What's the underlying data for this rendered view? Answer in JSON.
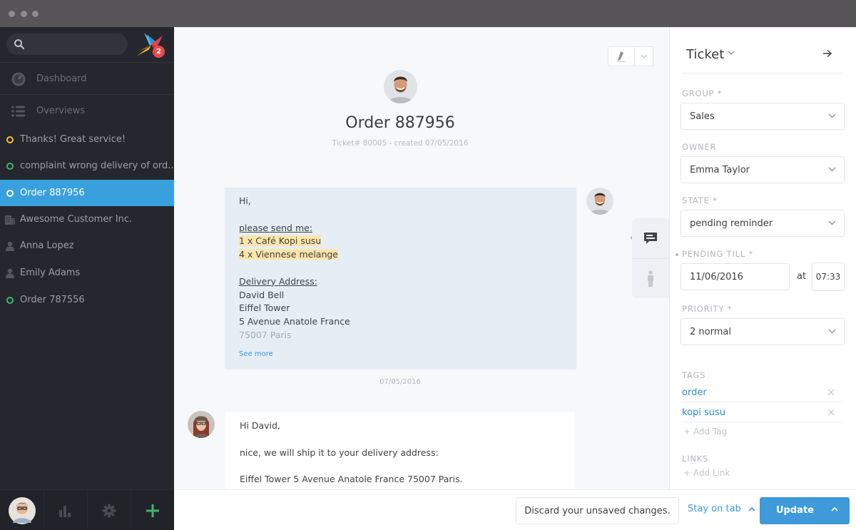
{
  "window": {
    "controls": [
      "close",
      "minimize",
      "maximize"
    ]
  },
  "sidebar": {
    "search": {
      "placeholder": "",
      "value": "",
      "icon": "search-icon"
    },
    "logo": {
      "icon": "zammad-bird-logo",
      "notification_count": "2"
    },
    "nav": [
      {
        "label": "Dashboard",
        "icon": "speedometer-icon"
      },
      {
        "label": "Overviews",
        "icon": "list-icon"
      }
    ],
    "items": [
      {
        "label": "Thanks! Great service!",
        "type": "ticket",
        "status_color": "#f4c22b",
        "active": false
      },
      {
        "label": "complaint wrong delivery of ord...",
        "type": "ticket",
        "status_color": "#3fb46b",
        "active": false
      },
      {
        "label": "Order 887956",
        "type": "ticket",
        "status_color": "#ffffff",
        "active": true
      },
      {
        "label": "Awesome Customer Inc.",
        "type": "organization",
        "icon": "building-icon",
        "active": false
      },
      {
        "label": "Anna Lopez",
        "type": "user",
        "icon": "person-icon",
        "active": false
      },
      {
        "label": "Emily Adams",
        "type": "user",
        "icon": "person-icon",
        "active": false
      },
      {
        "label": "Order 787556",
        "type": "ticket",
        "status_color": "#3fb46b",
        "active": false
      }
    ],
    "footer": [
      {
        "name": "avatar",
        "icon": "user-avatar"
      },
      {
        "name": "reports",
        "icon": "bar-chart-icon"
      },
      {
        "name": "settings",
        "icon": "gear-icon"
      },
      {
        "name": "new",
        "icon": "plus-icon",
        "color": "#3fb46b"
      }
    ]
  },
  "ticket": {
    "title": "Order 887956",
    "meta": "Ticket# 80005 - created 07/05/2016",
    "highlighter_icon": "highlighter-icon",
    "articles": [
      {
        "sender": "customer",
        "lines": [
          {
            "text": "Hi,",
            "style": "normal"
          },
          {
            "text": "",
            "style": "blank"
          },
          {
            "text": "please send me:",
            "style": "underline"
          },
          {
            "text": "1 x Café Kopi susu",
            "style": "highlight"
          },
          {
            "text": "4 x Viennese melange",
            "style": "highlight"
          },
          {
            "text": "",
            "style": "blank"
          },
          {
            "text": "Delivery Address:",
            "style": "underline"
          },
          {
            "text": "David Bell",
            "style": "normal"
          },
          {
            "text": "Eiffel Tower",
            "style": "normal"
          },
          {
            "text": "5 Avenue Anatole France",
            "style": "normal"
          },
          {
            "text": "75007 Paris",
            "style": "faded"
          }
        ],
        "see_more": "See more"
      },
      {
        "sender": "agent",
        "lines": [
          {
            "text": "Hi David,",
            "style": "normal"
          },
          {
            "text": "",
            "style": "blank"
          },
          {
            "text": "nice, we will ship it to your delivery address:",
            "style": "normal"
          },
          {
            "text": "",
            "style": "blank"
          },
          {
            "text": "Eiffel Tower 5 Avenue Anatole France 75007 Paris.",
            "style": "normal"
          }
        ]
      }
    ],
    "date_separator": "07/05/2016",
    "side_tabs": [
      {
        "name": "ticket",
        "icon": "chat-bubble-icon",
        "active": true
      },
      {
        "name": "customer",
        "icon": "person-icon",
        "active": false
      }
    ]
  },
  "panel": {
    "title": "Ticket",
    "fields": {
      "group": {
        "label": "GROUP *",
        "value": "Sales"
      },
      "owner": {
        "label": "OWNER",
        "value": "Emma Taylor"
      },
      "state": {
        "label": "STATE *",
        "value": "pending reminder"
      },
      "pending_till": {
        "label": "PENDING TILL *",
        "date": "11/06/2016",
        "at": "at",
        "time": "07:33"
      },
      "priority": {
        "label": "PRIORITY *",
        "value": "2 normal"
      }
    },
    "tags": {
      "label": "TAGS",
      "items": [
        "order",
        "kopi susu"
      ],
      "add": "+ Add Tag"
    },
    "links": {
      "label": "LINKS",
      "add": "+ Add Link"
    }
  },
  "bottom_bar": {
    "discard": "Discard your unsaved changes.",
    "stay_on_tab": "Stay on tab",
    "update": "Update"
  },
  "colors": {
    "accent": "#38a0dc",
    "sidebar_bg": "#26272e",
    "tag": "#2d8ac7",
    "highlight": "#fbe5a9",
    "badge": "#e54b4b"
  }
}
